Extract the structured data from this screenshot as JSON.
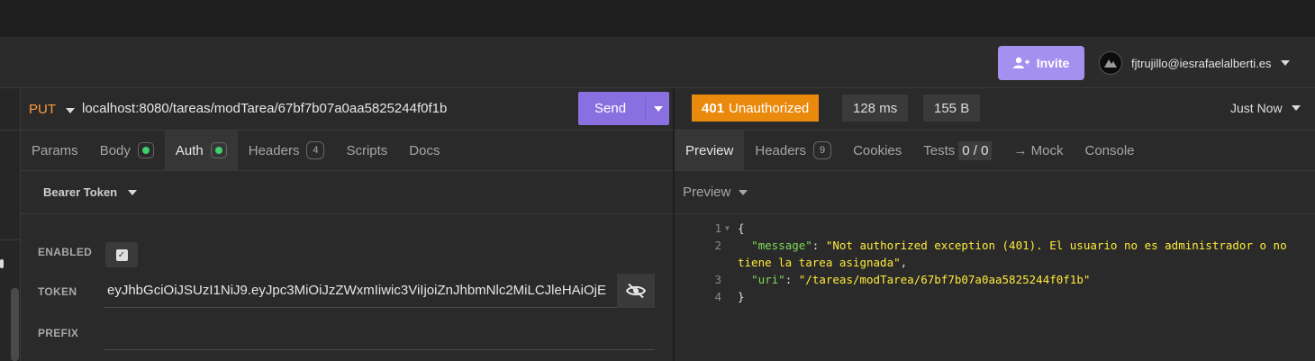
{
  "header": {
    "invite_label": "Invite",
    "user_email": "fjtrujillo@iesrafaelalberti.es"
  },
  "request": {
    "method": "PUT",
    "url": "localhost:8080/tareas/modTarea/67bf7b07a0aa5825244f0f1b",
    "send_label": "Send",
    "tabs": [
      {
        "label": "Params"
      },
      {
        "label": "Body"
      },
      {
        "label": "Auth"
      },
      {
        "label": "Headers",
        "count": "4"
      },
      {
        "label": "Scripts"
      },
      {
        "label": "Docs"
      }
    ],
    "auth_type": "Bearer Token",
    "enabled_label": "ENABLED",
    "token_label": "TOKEN",
    "token_value": "eyJhbGciOiJSUzI1NiJ9.eyJpc3MiOiJzZWxmIiwic3ViIjoiZnJhbmNlc2MiLCJleHAiOjE",
    "prefix_label": "PREFIX",
    "prefix_value": ""
  },
  "response": {
    "status_code": "401",
    "status_text": "Unauthorized",
    "time": "128 ms",
    "size": "155 B",
    "timestamp": "Just Now",
    "tabs": [
      {
        "label": "Preview"
      },
      {
        "label": "Headers",
        "count": "9"
      },
      {
        "label": "Cookies"
      },
      {
        "label": "Tests",
        "count": "0 / 0"
      },
      {
        "label": "→ Mock"
      },
      {
        "label": "Console"
      }
    ],
    "preview_mode": "Preview",
    "line_numbers": [
      "1",
      "2",
      "3",
      "4"
    ],
    "body": {
      "open": "{",
      "message_key": "\"message\"",
      "message_value_1": "\"Not authorized exception (401). El usuario no es administrador o no",
      "message_value_2": "tiene la tarea asignada\"",
      "uri_key": "\"uri\"",
      "uri_value": "\"/tareas/modTarea/67bf7b07a0aa5825244f0f1b\"",
      "close": "}"
    }
  },
  "colors": {
    "accent": "#8a6fe0",
    "status_error": "#ea8a0c",
    "method": "#ff9a3d",
    "json_key": "#7ed957",
    "json_string": "#ffeb3b"
  },
  "icons": [
    "add-user-icon",
    "avatar",
    "caret-down-icon",
    "eye-slash-icon",
    "checkbox-checked-icon",
    "fold-arrow-icon"
  ]
}
